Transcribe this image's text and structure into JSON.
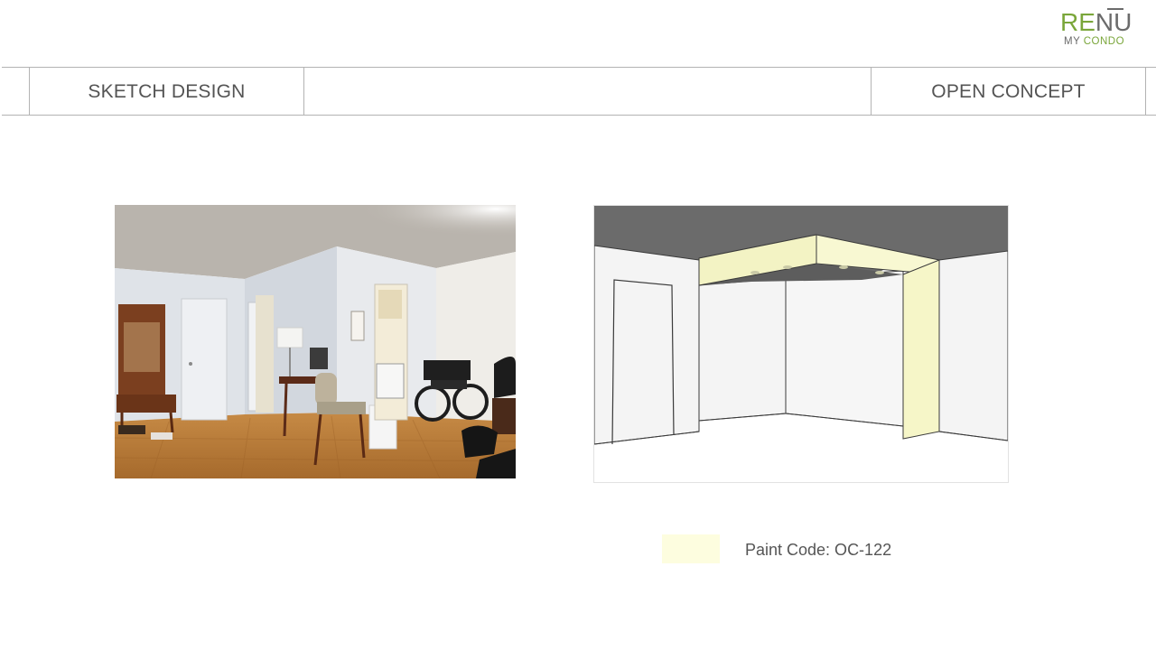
{
  "logo": {
    "re": "RE",
    "nu": "NU",
    "my": "MY",
    "condo": "CONDO",
    "brand_color": "#7aa63a"
  },
  "header": {
    "left_title": "SKETCH DESIGN",
    "right_title": "OPEN CONCEPT"
  },
  "swatch": {
    "color": "#fdfddf",
    "label": "Paint Code: OC-122"
  }
}
